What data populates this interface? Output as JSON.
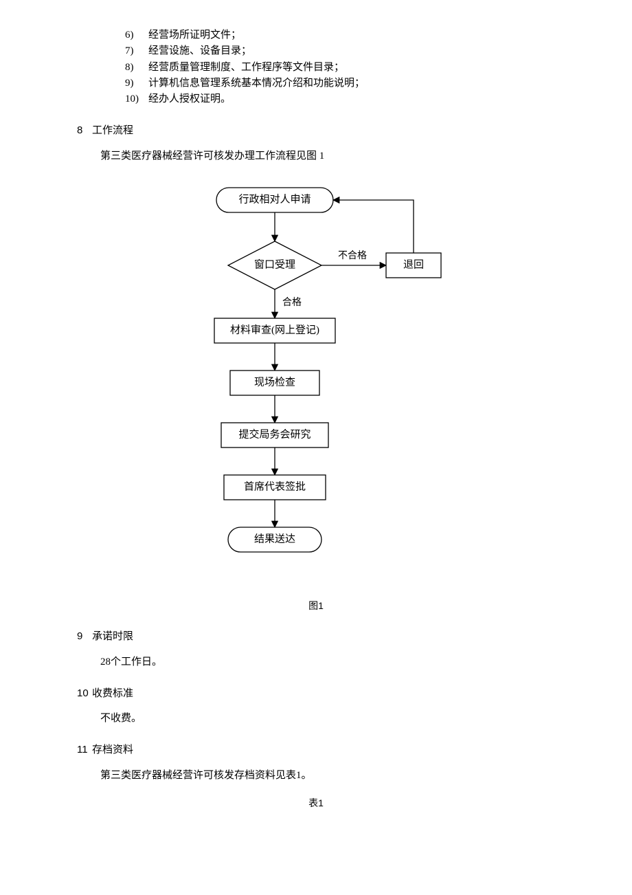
{
  "list_items": [
    {
      "n": "6)",
      "t": "经营场所证明文件；"
    },
    {
      "n": "7)",
      "t": "经营设施、设备目录；"
    },
    {
      "n": "8)",
      "t": "经营质量管理制度、工作程序等文件目录；"
    },
    {
      "n": "9)",
      "t": "计算机信息管理系统基本情况介绍和功能说明；"
    },
    {
      "n": "10)",
      "t": "经办人授权证明。"
    }
  ],
  "sec8": {
    "n": "8",
    "title": "工作流程",
    "body": "第三类医疗器械经营许可核发办理工作流程见图 1"
  },
  "sec9": {
    "n": "9",
    "title": "承诺时限",
    "body": "28个工作日。"
  },
  "sec10": {
    "n": "10",
    "title": "收费标准",
    "body": "不收费。"
  },
  "sec11": {
    "n": "11",
    "title": "存档资料",
    "body": "第三类医疗器械经营许可核发存档资料见表1。"
  },
  "fig_caption": "图1",
  "tbl_caption": "表1",
  "chart_data": {
    "type": "flowchart",
    "nodes": [
      {
        "id": "apply",
        "shape": "terminal",
        "label": "行政相对人申请"
      },
      {
        "id": "accept",
        "shape": "decision",
        "label": "窗口受理"
      },
      {
        "id": "return",
        "shape": "process",
        "label": "退回"
      },
      {
        "id": "review",
        "shape": "process",
        "label": "材料审查(网上登记)"
      },
      {
        "id": "inspect",
        "shape": "process",
        "label": "现场检查"
      },
      {
        "id": "submit",
        "shape": "process",
        "label": "提交局务会研究"
      },
      {
        "id": "approve",
        "shape": "process",
        "label": "首席代表签批"
      },
      {
        "id": "deliver",
        "shape": "terminal",
        "label": "结果送达"
      }
    ],
    "edges": [
      {
        "from": "apply",
        "to": "accept",
        "label": ""
      },
      {
        "from": "accept",
        "to": "return",
        "label": "不合格"
      },
      {
        "from": "return",
        "to": "apply",
        "label": ""
      },
      {
        "from": "accept",
        "to": "review",
        "label": "合格"
      },
      {
        "from": "review",
        "to": "inspect",
        "label": ""
      },
      {
        "from": "inspect",
        "to": "submit",
        "label": ""
      },
      {
        "from": "submit",
        "to": "approve",
        "label": ""
      },
      {
        "from": "approve",
        "to": "deliver",
        "label": ""
      }
    ]
  }
}
